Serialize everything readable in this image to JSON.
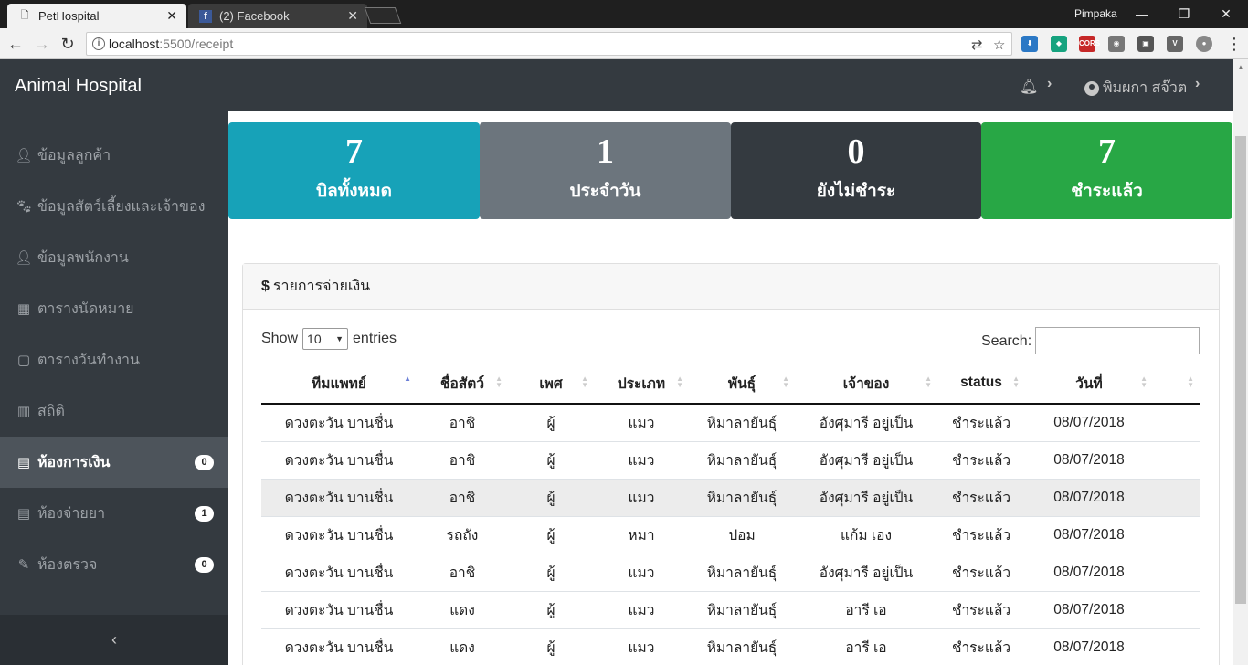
{
  "browser": {
    "tabs": [
      {
        "title": "PetHospital",
        "active": true
      },
      {
        "title": "(2) Facebook",
        "active": false
      }
    ],
    "user": "Pimpaka",
    "url_host": "localhost",
    "url_path": ":5500/receipt",
    "ext_cors": "CORS"
  },
  "app": {
    "brand": "Animal Hospital",
    "user_name": "พิมผกา สจ๊วต"
  },
  "sidebar": {
    "items": [
      {
        "label": "ข้อมูลลูกค้า",
        "icon": "user-icon",
        "badge": ""
      },
      {
        "label": "ข้อมูลสัตว์เลี้ยงและเจ้าของ",
        "icon": "paw-icon",
        "badge": ""
      },
      {
        "label": "ข้อมูลพนักงาน",
        "icon": "user-icon",
        "badge": ""
      },
      {
        "label": "ตารางนัดหมาย",
        "icon": "calendar-icon",
        "badge": ""
      },
      {
        "label": "ตารางวันทำงาน",
        "icon": "calendar-icon",
        "badge": ""
      },
      {
        "label": "สถิติ",
        "icon": "chart-icon",
        "badge": ""
      },
      {
        "label": "ห้องการเงิน",
        "icon": "money-icon",
        "badge": "0",
        "active": true
      },
      {
        "label": "ห้องจ่ายยา",
        "icon": "pill-icon",
        "badge": "1"
      },
      {
        "label": "ห้องตรวจ",
        "icon": "syringe-icon",
        "badge": "0"
      }
    ]
  },
  "stats": [
    {
      "value": "7",
      "label": "บิลทั้งหมด",
      "color": "#17a2b8"
    },
    {
      "value": "1",
      "label": "ประจำวัน",
      "color": "#6c757d"
    },
    {
      "value": "0",
      "label": "ยังไม่ชำระ",
      "color": "#343a40"
    },
    {
      "value": "7",
      "label": "ชำระแล้ว",
      "color": "#28a745"
    }
  ],
  "panel": {
    "title": "รายการจ่ายเงิน",
    "show": "Show",
    "length": "10",
    "entries": "entries",
    "search": "Search:"
  },
  "table": {
    "headers": [
      "ทีมแพทย์",
      "ชื่อสัตว์",
      "เพศ",
      "ประเภท",
      "พันธุ์",
      "เจ้าของ",
      "status",
      "วันที่"
    ],
    "rows": [
      [
        "ดวงตะวัน บานชื่น",
        "อาชิ",
        "ผู้",
        "แมว",
        "หิมาลายันธุ์",
        "อังศุมารี อยู่เป็น",
        "ชำระแล้ว",
        "08/07/2018"
      ],
      [
        "ดวงตะวัน บานชื่น",
        "อาชิ",
        "ผู้",
        "แมว",
        "หิมาลายันธุ์",
        "อังศุมารี อยู่เป็น",
        "ชำระแล้ว",
        "08/07/2018"
      ],
      [
        "ดวงตะวัน บานชื่น",
        "อาชิ",
        "ผู้",
        "แมว",
        "หิมาลายันธุ์",
        "อังศุมารี อยู่เป็น",
        "ชำระแล้ว",
        "08/07/2018"
      ],
      [
        "ดวงตะวัน บานชื่น",
        "รถถัง",
        "ผู้",
        "หมา",
        "ปอม",
        "แก้ม เอง",
        "ชำระแล้ว",
        "08/07/2018"
      ],
      [
        "ดวงตะวัน บานชื่น",
        "อาชิ",
        "ผู้",
        "แมว",
        "หิมาลายันธุ์",
        "อังศุมารี อยู่เป็น",
        "ชำระแล้ว",
        "08/07/2018"
      ],
      [
        "ดวงตะวัน บานชื่น",
        "แดง",
        "ผู้",
        "แมว",
        "หิมาลายันธุ์",
        "อารี เอ",
        "ชำระแล้ว",
        "08/07/2018"
      ],
      [
        "ดวงตะวัน บานชื่น",
        "แดง",
        "ผู้",
        "แมว",
        "หิมาลายันธุ์",
        "อารี เอ",
        "ชำระแล้ว",
        "08/07/2018"
      ]
    ]
  }
}
